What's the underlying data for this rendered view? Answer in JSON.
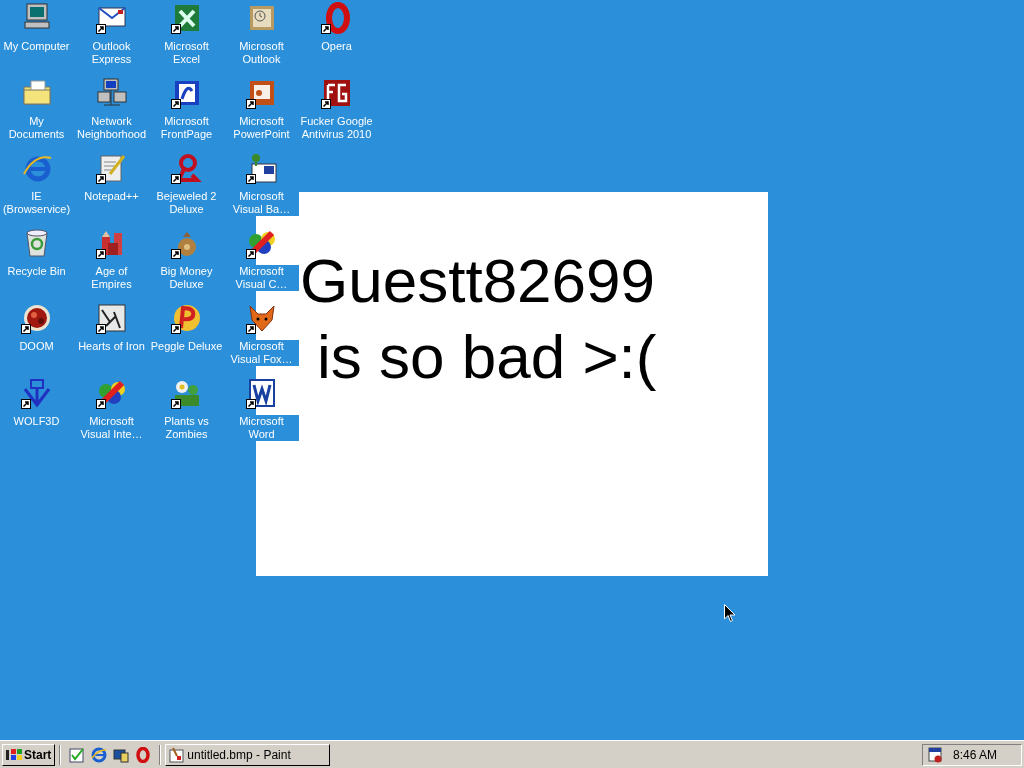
{
  "desktop": {
    "icon_rows": [
      [
        {
          "label": "My Computer",
          "shortcut": false
        },
        {
          "label": "Outlook Express",
          "shortcut": true
        },
        {
          "label": "Microsoft Excel",
          "shortcut": true
        },
        {
          "label": "Microsoft Outlook",
          "shortcut": false
        },
        {
          "label": "Opera",
          "shortcut": true
        }
      ],
      [
        {
          "label": "My Documents",
          "shortcut": false
        },
        {
          "label": "Network Neighborhood",
          "shortcut": false
        },
        {
          "label": "Microsoft FrontPage",
          "shortcut": true
        },
        {
          "label": "Microsoft PowerPoint",
          "shortcut": true
        },
        {
          "label": "Fucker Google Antivirus 2010",
          "shortcut": true
        }
      ],
      [
        {
          "label": "IE (Browservice)",
          "shortcut": false
        },
        {
          "label": "Notepad++",
          "shortcut": true
        },
        {
          "label": "Bejeweled 2 Deluxe",
          "shortcut": true
        },
        {
          "label": "Microsoft Visual Ba…",
          "shortcut": true
        }
      ],
      [
        {
          "label": "Recycle Bin",
          "shortcut": false
        },
        {
          "label": "Age of Empires",
          "shortcut": true
        },
        {
          "label": "Big Money Deluxe",
          "shortcut": true
        },
        {
          "label": "Microsoft Visual C…",
          "shortcut": true
        }
      ],
      [
        {
          "label": "DOOM",
          "shortcut": true
        },
        {
          "label": "Hearts of Iron",
          "shortcut": true
        },
        {
          "label": "Peggle Deluxe",
          "shortcut": true
        },
        {
          "label": "Microsoft Visual Fox…",
          "shortcut": true
        }
      ],
      [
        {
          "label": "WOLF3D",
          "shortcut": true
        },
        {
          "label": "Microsoft Visual Inte…",
          "shortcut": true
        },
        {
          "label": "Plants vs Zombies",
          "shortcut": true
        },
        {
          "label": "Microsoft Word",
          "shortcut": true
        }
      ]
    ]
  },
  "image_window": {
    "lines": [
      "Guestt82699",
      "is so bad >:("
    ]
  },
  "taskbar": {
    "start": "Start",
    "tasks": [
      {
        "label": "untitled.bmp - Paint",
        "selected": false
      }
    ],
    "clock": "8:46 AM"
  }
}
